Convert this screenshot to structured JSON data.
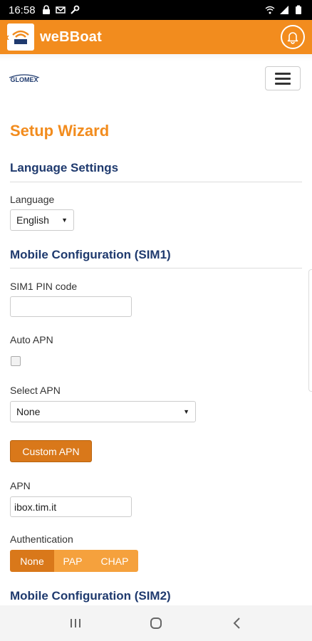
{
  "status_bar": {
    "time": "16:58"
  },
  "app_bar": {
    "title": "weBBoat"
  },
  "brand": {
    "logo_text": "GLOMEX"
  },
  "page": {
    "title": "Setup Wizard"
  },
  "language_section": {
    "title": "Language Settings",
    "language_label": "Language",
    "language_value": "English"
  },
  "sim1_section": {
    "title": "Mobile Configuration (SIM1)",
    "pin_label": "SIM1 PIN code",
    "pin_value": "",
    "auto_apn_label": "Auto APN",
    "auto_apn_checked": false,
    "select_apn_label": "Select APN",
    "select_apn_value": "None",
    "custom_apn_button": "Custom APN",
    "apn_label": "APN",
    "apn_value": "ibox.tim.it",
    "auth_label": "Authentication",
    "auth_options": [
      "None",
      "PAP",
      "CHAP"
    ],
    "auth_selected": "None"
  },
  "sim2_section": {
    "title": "Mobile Configuration (SIM2)"
  },
  "colors": {
    "accent": "#f28c1e",
    "button": "#d9781a",
    "heading": "#1f3a6e"
  }
}
